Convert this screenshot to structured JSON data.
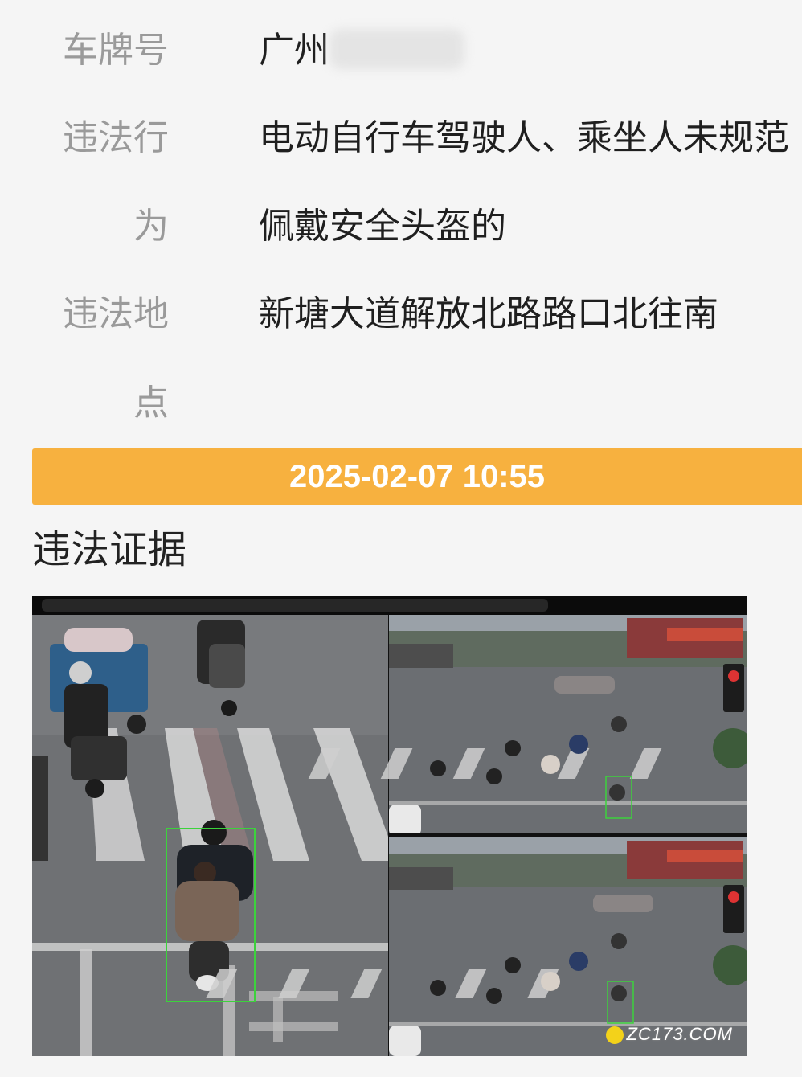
{
  "fields": {
    "plate_label": "车牌号",
    "plate_value": "广州",
    "behavior_label_line1": "违法行",
    "behavior_label_line2": "为",
    "behavior_value_line1": "电动自行车驾驶人、乘坐人未规范",
    "behavior_value_line2": "佩戴安全头盔的",
    "location_label_line1": "违法地",
    "location_label_line2": "点",
    "location_value": "新塘大道解放北路路口北往南"
  },
  "datetime": "2025-02-07 10:55",
  "evidence": {
    "title": "违法证据"
  },
  "watermark": "ZC173.COM",
  "colors": {
    "accent": "#f7b13f",
    "label": "#9a9a9a",
    "box": "#3cd23c"
  }
}
